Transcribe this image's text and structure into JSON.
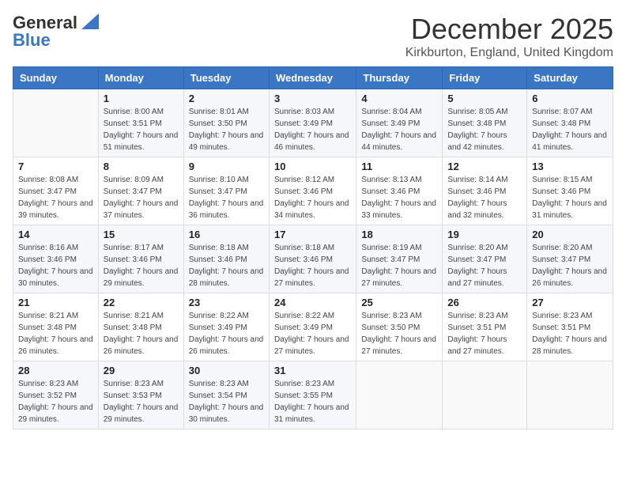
{
  "header": {
    "logo_line1": "General",
    "logo_line2": "Blue",
    "title": "December 2025",
    "subtitle": "Kirkburton, England, United Kingdom"
  },
  "days_of_week": [
    "Sunday",
    "Monday",
    "Tuesday",
    "Wednesday",
    "Thursday",
    "Friday",
    "Saturday"
  ],
  "weeks": [
    [
      {
        "day": "",
        "sunrise": "",
        "sunset": "",
        "daylight": ""
      },
      {
        "day": "1",
        "sunrise": "Sunrise: 8:00 AM",
        "sunset": "Sunset: 3:51 PM",
        "daylight": "Daylight: 7 hours and 51 minutes."
      },
      {
        "day": "2",
        "sunrise": "Sunrise: 8:01 AM",
        "sunset": "Sunset: 3:50 PM",
        "daylight": "Daylight: 7 hours and 49 minutes."
      },
      {
        "day": "3",
        "sunrise": "Sunrise: 8:03 AM",
        "sunset": "Sunset: 3:49 PM",
        "daylight": "Daylight: 7 hours and 46 minutes."
      },
      {
        "day": "4",
        "sunrise": "Sunrise: 8:04 AM",
        "sunset": "Sunset: 3:49 PM",
        "daylight": "Daylight: 7 hours and 44 minutes."
      },
      {
        "day": "5",
        "sunrise": "Sunrise: 8:05 AM",
        "sunset": "Sunset: 3:48 PM",
        "daylight": "Daylight: 7 hours and 42 minutes."
      },
      {
        "day": "6",
        "sunrise": "Sunrise: 8:07 AM",
        "sunset": "Sunset: 3:48 PM",
        "daylight": "Daylight: 7 hours and 41 minutes."
      }
    ],
    [
      {
        "day": "7",
        "sunrise": "Sunrise: 8:08 AM",
        "sunset": "Sunset: 3:47 PM",
        "daylight": "Daylight: 7 hours and 39 minutes."
      },
      {
        "day": "8",
        "sunrise": "Sunrise: 8:09 AM",
        "sunset": "Sunset: 3:47 PM",
        "daylight": "Daylight: 7 hours and 37 minutes."
      },
      {
        "day": "9",
        "sunrise": "Sunrise: 8:10 AM",
        "sunset": "Sunset: 3:47 PM",
        "daylight": "Daylight: 7 hours and 36 minutes."
      },
      {
        "day": "10",
        "sunrise": "Sunrise: 8:12 AM",
        "sunset": "Sunset: 3:46 PM",
        "daylight": "Daylight: 7 hours and 34 minutes."
      },
      {
        "day": "11",
        "sunrise": "Sunrise: 8:13 AM",
        "sunset": "Sunset: 3:46 PM",
        "daylight": "Daylight: 7 hours and 33 minutes."
      },
      {
        "day": "12",
        "sunrise": "Sunrise: 8:14 AM",
        "sunset": "Sunset: 3:46 PM",
        "daylight": "Daylight: 7 hours and 32 minutes."
      },
      {
        "day": "13",
        "sunrise": "Sunrise: 8:15 AM",
        "sunset": "Sunset: 3:46 PM",
        "daylight": "Daylight: 7 hours and 31 minutes."
      }
    ],
    [
      {
        "day": "14",
        "sunrise": "Sunrise: 8:16 AM",
        "sunset": "Sunset: 3:46 PM",
        "daylight": "Daylight: 7 hours and 30 minutes."
      },
      {
        "day": "15",
        "sunrise": "Sunrise: 8:17 AM",
        "sunset": "Sunset: 3:46 PM",
        "daylight": "Daylight: 7 hours and 29 minutes."
      },
      {
        "day": "16",
        "sunrise": "Sunrise: 8:18 AM",
        "sunset": "Sunset: 3:46 PM",
        "daylight": "Daylight: 7 hours and 28 minutes."
      },
      {
        "day": "17",
        "sunrise": "Sunrise: 8:18 AM",
        "sunset": "Sunset: 3:46 PM",
        "daylight": "Daylight: 7 hours and 27 minutes."
      },
      {
        "day": "18",
        "sunrise": "Sunrise: 8:19 AM",
        "sunset": "Sunset: 3:47 PM",
        "daylight": "Daylight: 7 hours and 27 minutes."
      },
      {
        "day": "19",
        "sunrise": "Sunrise: 8:20 AM",
        "sunset": "Sunset: 3:47 PM",
        "daylight": "Daylight: 7 hours and 27 minutes."
      },
      {
        "day": "20",
        "sunrise": "Sunrise: 8:20 AM",
        "sunset": "Sunset: 3:47 PM",
        "daylight": "Daylight: 7 hours and 26 minutes."
      }
    ],
    [
      {
        "day": "21",
        "sunrise": "Sunrise: 8:21 AM",
        "sunset": "Sunset: 3:48 PM",
        "daylight": "Daylight: 7 hours and 26 minutes."
      },
      {
        "day": "22",
        "sunrise": "Sunrise: 8:21 AM",
        "sunset": "Sunset: 3:48 PM",
        "daylight": "Daylight: 7 hours and 26 minutes."
      },
      {
        "day": "23",
        "sunrise": "Sunrise: 8:22 AM",
        "sunset": "Sunset: 3:49 PM",
        "daylight": "Daylight: 7 hours and 26 minutes."
      },
      {
        "day": "24",
        "sunrise": "Sunrise: 8:22 AM",
        "sunset": "Sunset: 3:49 PM",
        "daylight": "Daylight: 7 hours and 27 minutes."
      },
      {
        "day": "25",
        "sunrise": "Sunrise: 8:23 AM",
        "sunset": "Sunset: 3:50 PM",
        "daylight": "Daylight: 7 hours and 27 minutes."
      },
      {
        "day": "26",
        "sunrise": "Sunrise: 8:23 AM",
        "sunset": "Sunset: 3:51 PM",
        "daylight": "Daylight: 7 hours and 27 minutes."
      },
      {
        "day": "27",
        "sunrise": "Sunrise: 8:23 AM",
        "sunset": "Sunset: 3:51 PM",
        "daylight": "Daylight: 7 hours and 28 minutes."
      }
    ],
    [
      {
        "day": "28",
        "sunrise": "Sunrise: 8:23 AM",
        "sunset": "Sunset: 3:52 PM",
        "daylight": "Daylight: 7 hours and 29 minutes."
      },
      {
        "day": "29",
        "sunrise": "Sunrise: 8:23 AM",
        "sunset": "Sunset: 3:53 PM",
        "daylight": "Daylight: 7 hours and 29 minutes."
      },
      {
        "day": "30",
        "sunrise": "Sunrise: 8:23 AM",
        "sunset": "Sunset: 3:54 PM",
        "daylight": "Daylight: 7 hours and 30 minutes."
      },
      {
        "day": "31",
        "sunrise": "Sunrise: 8:23 AM",
        "sunset": "Sunset: 3:55 PM",
        "daylight": "Daylight: 7 hours and 31 minutes."
      },
      {
        "day": "",
        "sunrise": "",
        "sunset": "",
        "daylight": ""
      },
      {
        "day": "",
        "sunrise": "",
        "sunset": "",
        "daylight": ""
      },
      {
        "day": "",
        "sunrise": "",
        "sunset": "",
        "daylight": ""
      }
    ]
  ]
}
